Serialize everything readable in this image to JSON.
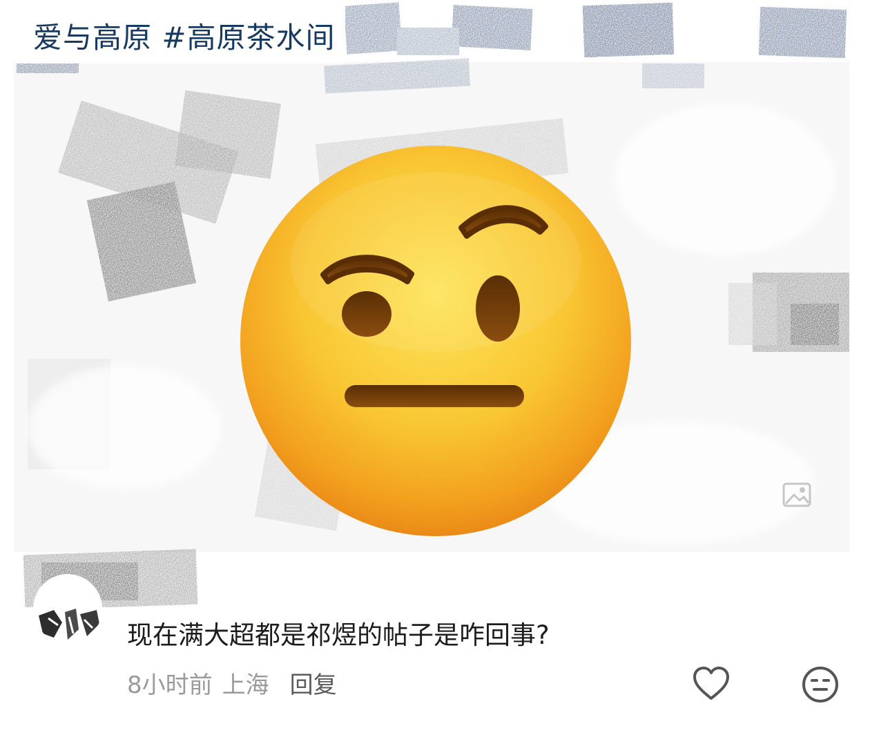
{
  "post": {
    "title": "爱与高原 #高原茶水间",
    "image_icon": "image-placeholder-icon",
    "sticker": "face-with-raised-eyebrow-emoji"
  },
  "comment": {
    "text": "现在满大超都是祁煜的帖子是咋回事?",
    "time": "8小时前",
    "location": "上海",
    "reply_label": "回复",
    "like_icon": "heart-outline-icon",
    "react_icon": "expressionless-face-icon"
  },
  "colors": {
    "title": "#163a5f",
    "comment_text": "#1c1c1c",
    "meta_text": "#9a9a9a",
    "reply_text": "#5a5a5a",
    "emoji_yellow": "#f9c633",
    "emoji_feature": "#6b3a07"
  }
}
